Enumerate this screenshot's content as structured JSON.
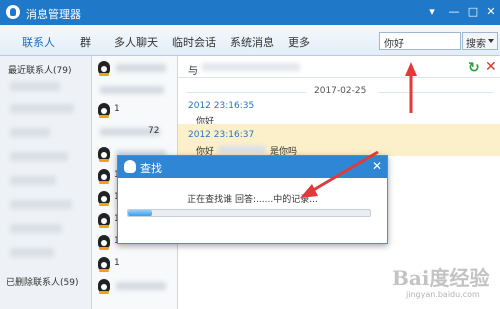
{
  "window": {
    "title": "消息管理器",
    "controls": [
      "▾",
      "—",
      "□",
      "✕"
    ]
  },
  "nav": {
    "tabs": [
      {
        "label": "联系人",
        "active": true
      },
      {
        "label": "群",
        "active": false
      },
      {
        "label": "多人聊天",
        "active": false
      },
      {
        "label": "临时会话",
        "active": false
      },
      {
        "label": "系统消息",
        "active": false
      },
      {
        "label": "更多",
        "active": false
      }
    ],
    "search_value": "你好",
    "search_button": "搜索"
  },
  "groups": {
    "recent_label": "最近联系人(79)",
    "deleted_label": "已删除联系人(59)"
  },
  "contacts": {
    "row_marks": [
      "1",
      "1",
      "72",
      "1",
      "1",
      "1",
      "1",
      "1"
    ]
  },
  "messages": {
    "with_prefix": "与",
    "date": "2017-02-25",
    "items": [
      {
        "time": "2012 23:16:35",
        "text": "你好"
      },
      {
        "time": "2012 23:16:37",
        "text": "你好"
      }
    ],
    "trailing_text": "是你吗"
  },
  "dialog": {
    "title": "查找",
    "close": "✕",
    "status": "正在查找谁 回答:......中的记录...",
    "progress": 0.1
  },
  "watermark": {
    "text": "Bai度经验",
    "sub": "jingyan.baidu.com"
  },
  "colors": {
    "titlebar": "#1f78c8",
    "accent": "#2a73c2",
    "highlight": "#fbf0c9",
    "arrow": "#e03a3a"
  }
}
